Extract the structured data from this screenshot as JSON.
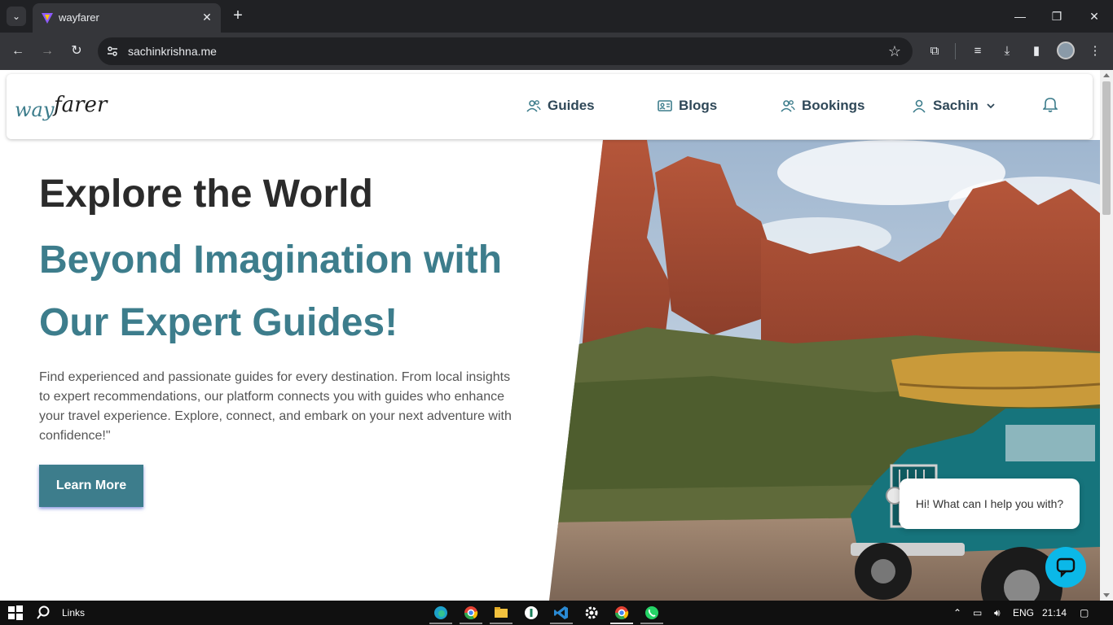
{
  "browser": {
    "tab_title": "wayfarer",
    "url": "sachinkrishna.me"
  },
  "site": {
    "logo_part1": "way",
    "logo_part2": "farer",
    "nav": [
      {
        "label": "Guides",
        "icon": "users-icon"
      },
      {
        "label": "Blogs",
        "icon": "id-card-icon"
      },
      {
        "label": "Bookings",
        "icon": "users-icon"
      },
      {
        "label": "Sachin",
        "icon": "user-icon"
      }
    ],
    "bell_icon": "bell-icon"
  },
  "hero": {
    "title": "Explore the World",
    "subtitle_line1": "Beyond Imagination with",
    "subtitle_line2": "Our Expert Guides!",
    "description": "Find experienced and passionate guides for every destination. From local insights to expert recommendations, our platform connects you with guides who enhance your travel experience. Explore, connect, and embark on your next adventure with confidence!\"",
    "cta_label": "Learn More"
  },
  "chat": {
    "greeting": "Hi! What can I help you with?"
  },
  "taskbar": {
    "search_label": "Links",
    "language": "ENG",
    "time": "21:14"
  },
  "colors": {
    "accent": "#3d7d8c",
    "nav_text": "#2f4858",
    "chat_button": "#0bb8e8",
    "chrome_dark": "#202124",
    "chrome_mid": "#35363a"
  }
}
